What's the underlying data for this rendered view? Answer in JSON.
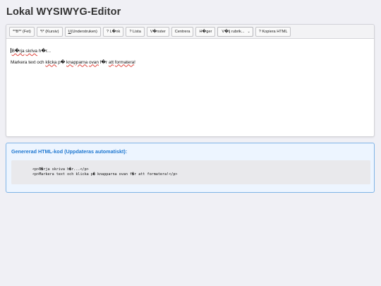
{
  "page": {
    "title": "Lokal WYSIWYG-Editor"
  },
  "toolbar": {
    "bold_label": "**B** (Fet)",
    "italic_label": "*I* (Kursiv)",
    "underline_short": "U",
    "underline_rest": " (Understruken)",
    "link_label": "? L�nk",
    "list_label": "? Lista",
    "left_label": "V�nster",
    "center_label": "Centrera",
    "right_label": "H�ger",
    "heading_select_value": "V�lj rubrik...",
    "copy_label": "? Kopiera HTML"
  },
  "editor": {
    "line1_word1": "B�rja",
    "line1_word2": "skriva",
    "line1_rest": " h�r...",
    "line2_part1": "Markera text och ",
    "line2_word_klicka": "klicka",
    "line2_part2": " p� ",
    "line2_word_knapparna": "knapparna",
    "line2_part3": " ",
    "line2_word_ovan": "ovan",
    "line2_part4": " f�r ",
    "line2_word_att": "att",
    "line2_part5": " ",
    "line2_word_formatera": "formatera",
    "line2_end": "!"
  },
  "output": {
    "title": "Genererad HTML-kod (Uppdateras automatiskt):",
    "code_line1": "<p>B�rja skriva h�r...</p>",
    "code_line2": "<p>Markera text och klicka p� knapparna ovan f�r att formatera!</p>"
  }
}
